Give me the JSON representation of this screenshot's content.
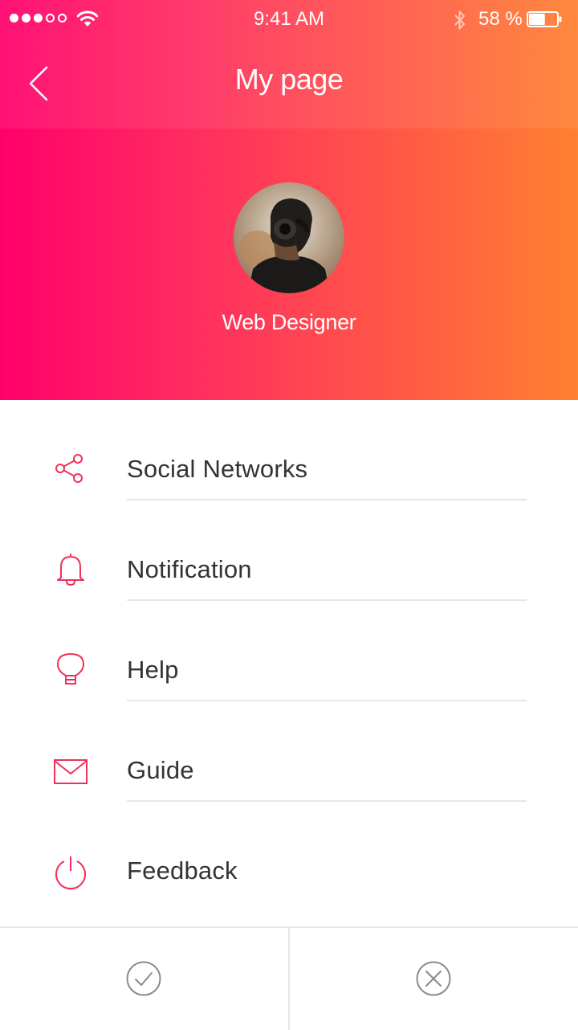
{
  "status_bar": {
    "time": "9:41 AM",
    "battery_percent": "58 %",
    "battery_level": 0.58,
    "signal_bars": 3
  },
  "header": {
    "title": "My page",
    "back_icon": "chevron-left-icon"
  },
  "profile": {
    "role": "Web Designer",
    "avatar": "avatar-photo"
  },
  "menu": {
    "items": [
      {
        "label": "Social Networks",
        "icon": "share-icon"
      },
      {
        "label": "Notification",
        "icon": "bell-icon"
      },
      {
        "label": "Help",
        "icon": "lightbulb-icon"
      },
      {
        "label": "Guide",
        "icon": "mail-icon"
      },
      {
        "label": "Feedback",
        "icon": "power-icon"
      }
    ]
  },
  "footer": {
    "confirm_icon": "check-circle-icon",
    "cancel_icon": "close-circle-icon"
  },
  "colors": {
    "gradient_start": "#ff006b",
    "gradient_end": "#ff8030",
    "accent": "#f0305a",
    "text": "#333333",
    "divider": "#e6e6e6"
  }
}
